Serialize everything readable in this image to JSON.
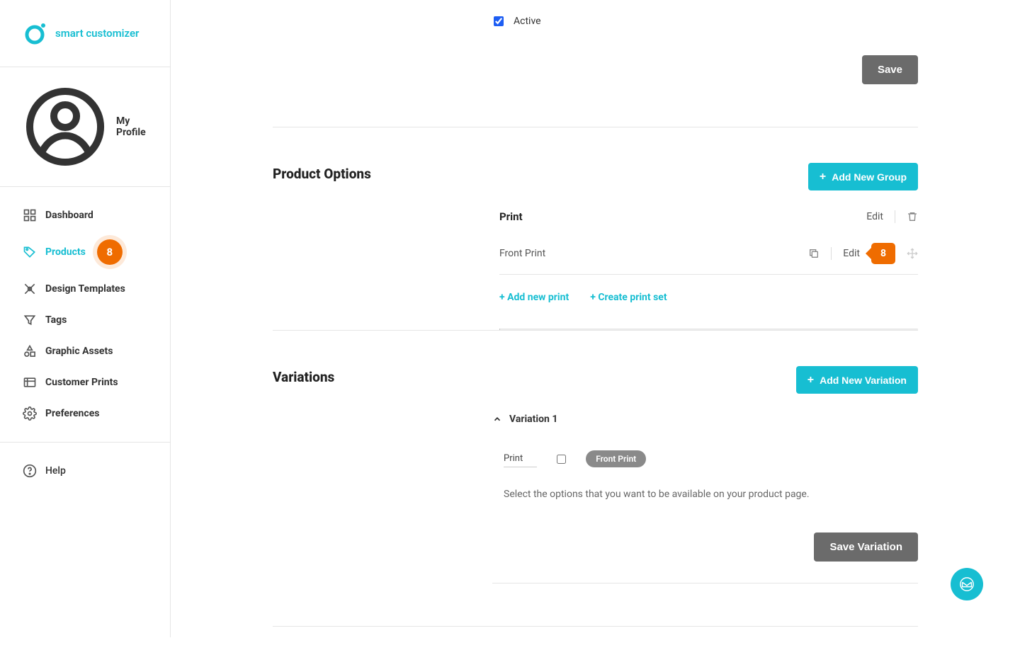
{
  "logo": {
    "text": "smart customizer"
  },
  "profile": {
    "label": "My Profile"
  },
  "nav": {
    "dashboard": "Dashboard",
    "products": "Products",
    "products_badge": "8",
    "design_templates": "Design Templates",
    "tags": "Tags",
    "graphic_assets": "Graphic Assets",
    "customer_prints": "Customer Prints",
    "preferences": "Preferences",
    "help": "Help"
  },
  "top_section": {
    "active_label": "Active",
    "active_checked": true,
    "save_label": "Save"
  },
  "product_options": {
    "title": "Product Options",
    "add_group_label": "Add New Group",
    "group_name": "Print",
    "group_edit_label": "Edit",
    "item_name": "Front Print",
    "item_edit_label": "Edit",
    "item_badge": "8",
    "add_new_print": "+ Add new print",
    "create_print_set": "+ Create print set"
  },
  "variations": {
    "title": "Variations",
    "add_variation_label": "Add New Variation",
    "variation_name": "Variation 1",
    "print_label": "Print",
    "chip_label": "Front Print",
    "help_text": "Select the options that you want to be available on your product page.",
    "save_variation_label": "Save Variation"
  }
}
